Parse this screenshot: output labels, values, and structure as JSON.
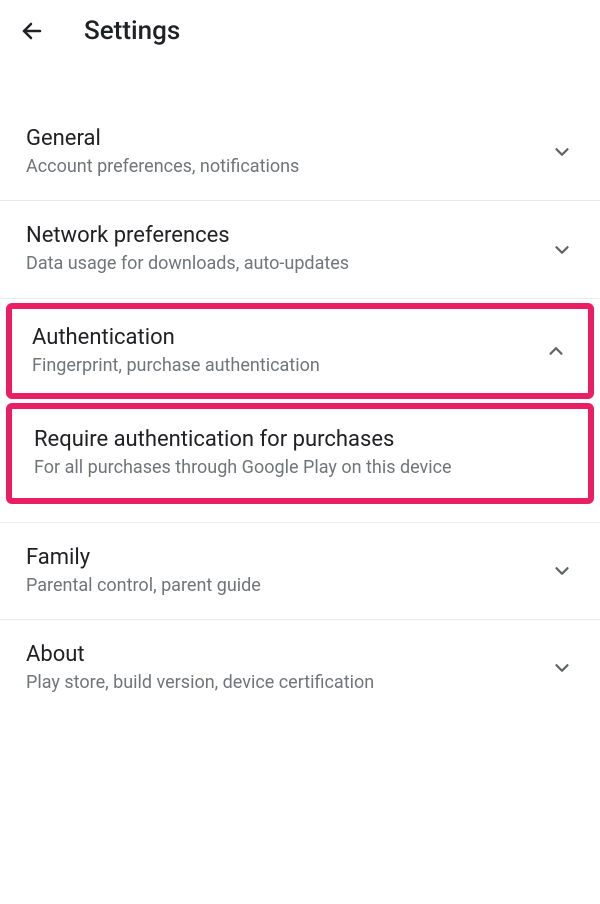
{
  "header": {
    "title": "Settings"
  },
  "sections": {
    "general": {
      "title": "General",
      "subtitle": "Account preferences, notifications"
    },
    "network": {
      "title": "Network preferences",
      "subtitle": "Data usage for downloads, auto-updates"
    },
    "authentication": {
      "title": "Authentication",
      "subtitle": "Fingerprint, purchase authentication"
    },
    "require_auth": {
      "title": "Require authentication for purchases",
      "subtitle": "For all purchases through Google Play on this device"
    },
    "family": {
      "title": "Family",
      "subtitle": "Parental control, parent guide"
    },
    "about": {
      "title": "About",
      "subtitle": "Play store, build version, device certification"
    }
  },
  "highlight_color": "#e91e63"
}
